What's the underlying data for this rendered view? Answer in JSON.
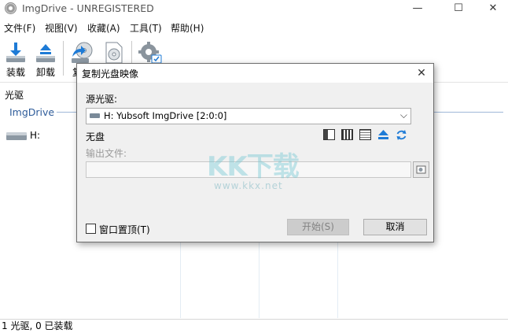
{
  "window": {
    "title": "ImgDrive - UNREGISTERED",
    "min_glyph": "—",
    "max_glyph": "☐",
    "close_glyph": "✕"
  },
  "menu": [
    {
      "label": "文件(F)"
    },
    {
      "label": "视图(V)"
    },
    {
      "label": "收藏(A)"
    },
    {
      "label": "工具(T)"
    },
    {
      "label": "帮助(H)"
    }
  ],
  "toolbar": {
    "mount_label": "装载",
    "unmount_label": "卸载",
    "copy_label": "复"
  },
  "content": {
    "drives_label": "光驱",
    "imgdrive_group": "ImgDrive",
    "drive_h": "H:"
  },
  "statusbar": {
    "text": "1 光驱, 0 已装载"
  },
  "dialog": {
    "title": "复制光盘映像",
    "close_glyph": "✕",
    "source_label": "源光驱:",
    "source_value": "H: Yubsoft ImgDrive [2:0:0]",
    "status": "无盘",
    "output_label": "输出文件:",
    "output_value": "",
    "ontop_label": "窗口置顶(T)",
    "start_label": "开始(S)",
    "cancel_label": "取消"
  },
  "watermark": {
    "logo": "KK下载",
    "url": "www.kkx.net"
  },
  "colors": {
    "accent": "#1e7bd6",
    "group_text": "#2e5c9a"
  }
}
